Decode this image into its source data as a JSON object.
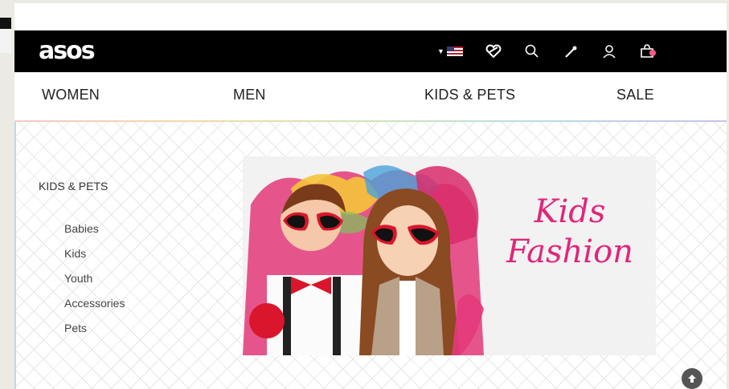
{
  "header": {
    "logo": "asos",
    "icons": [
      "country-flag-us-icon",
      "saved-items-heart-icon",
      "search-icon",
      "wand-icon",
      "account-user-icon",
      "shopping-bag-icon"
    ]
  },
  "nav": {
    "items": [
      "WOMEN",
      "MEN",
      "KIDS & PETS",
      "SALE"
    ]
  },
  "sidebar": {
    "title": "KIDS & PETS",
    "items": [
      "Babies",
      "Kids",
      "Youth",
      "Accessories",
      "Pets"
    ]
  },
  "banner": {
    "headline_line1": "Kids",
    "headline_line2": "Fashion"
  },
  "colors": {
    "topbar": "#000000",
    "banner_text": "#e0267a",
    "accent_pink": "#ff5b8a"
  }
}
